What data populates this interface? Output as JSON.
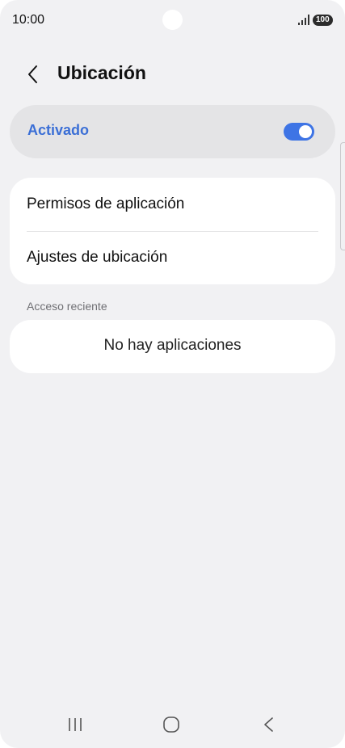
{
  "status_bar": {
    "time": "10:00",
    "battery": "100",
    "icons": [
      "signal-icon",
      "battery-icon"
    ]
  },
  "header": {
    "title": "Ubicación",
    "back_icon": "back-arrow-icon"
  },
  "master_switch": {
    "label": "Activado",
    "state": "on",
    "accent_color": "#3b6fd6"
  },
  "options": [
    {
      "label": "Permisos de aplicación"
    },
    {
      "label": "Ajustes de ubicación"
    }
  ],
  "recent_access": {
    "header": "Acceso reciente",
    "empty_text": "No hay aplicaciones"
  },
  "nav_bar": {
    "icons": [
      "recents-icon",
      "home-icon",
      "back-icon"
    ]
  }
}
